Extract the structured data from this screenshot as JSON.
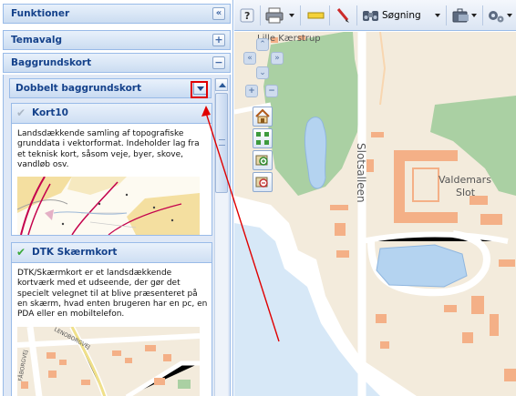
{
  "panel": {
    "funktioner": "Funktioner",
    "temavalg": "Temavalg",
    "baggrundskort": "Baggrundskort",
    "collapse_icon": "«",
    "expand_icon": "+",
    "minus_icon": "−"
  },
  "sub_panel": {
    "title": "Dobbelt baggrundskort"
  },
  "layers": [
    {
      "name": "Kort10",
      "selected": false,
      "description": "Landsdækkende samling af topografiske grunddata i vektorformat. Indeholder lag fra et teknisk kort, såsom veje, byer, skove, vandløb osv."
    },
    {
      "name": "DTK Skærmkort",
      "selected": true,
      "description": "DTK/Skærmkort er et landsdækkende kortværk med et udseende, der gør det specielt velegnet til at blive præsenteret på en skærm, hvad enten brugeren har en pc, en PDA eller en mobiltelefon."
    }
  ],
  "thumb_labels": [
    "FÅBORGVEJ",
    "LENOBORGVEJ"
  ],
  "toolbar": {
    "help": "?",
    "search_label": "Søgning"
  },
  "map": {
    "place_labels": [
      "Lille Kærstrup",
      "Slotsalleen",
      "Valdemars",
      "Slot"
    ]
  },
  "colors": {
    "header_text": "#15428b",
    "accent_border": "#99bbe8",
    "annotation": "#e00000",
    "water": "#b4d3f0",
    "forest": "#aad0a3",
    "building": "#f4b087"
  }
}
